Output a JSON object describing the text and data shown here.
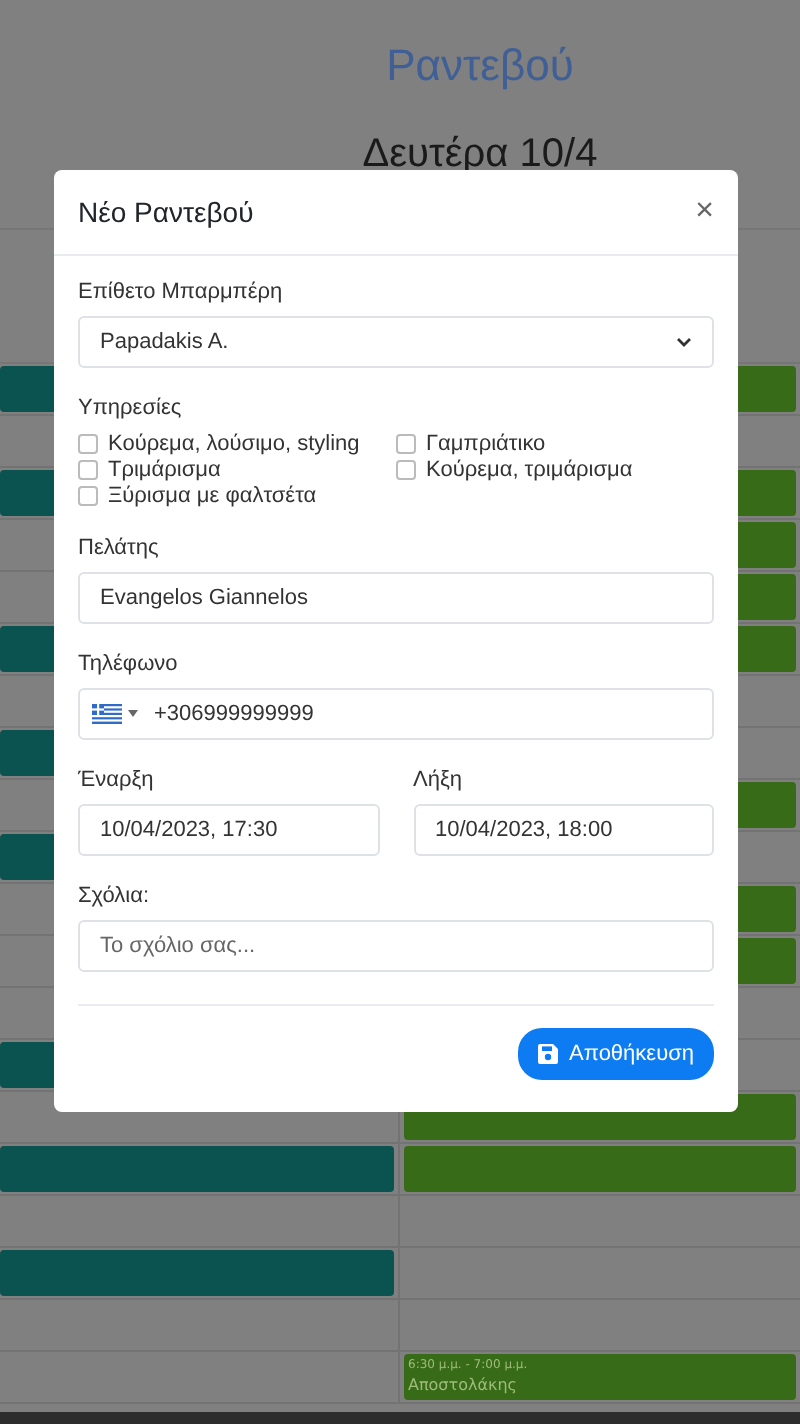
{
  "page": {
    "title": "Ραντεβού",
    "day_heading": "Δευτέρα 10/4"
  },
  "calendar": {
    "rows": [
      {
        "left_booked": true,
        "right_booked": true
      },
      {
        "left_booked": false,
        "right_booked": false
      },
      {
        "left_booked": true,
        "right_booked": true
      },
      {
        "left_booked": false,
        "right_booked": true
      },
      {
        "left_booked": false,
        "right_booked": true
      },
      {
        "left_booked": true,
        "right_booked": true
      },
      {
        "left_booked": false,
        "right_booked": false
      },
      {
        "left_booked": true,
        "right_booked": false
      },
      {
        "left_booked": false,
        "right_booked": true
      },
      {
        "left_booked": true,
        "right_booked": false
      },
      {
        "left_booked": false,
        "right_booked": true
      },
      {
        "left_booked": false,
        "right_booked": true
      },
      {
        "left_booked": false,
        "right_booked": false
      },
      {
        "left_booked": true,
        "right_booked": false
      },
      {
        "left_booked": false,
        "right_booked": true
      },
      {
        "left_booked": true,
        "right_booked": true
      },
      {
        "left_booked": false,
        "right_booked": false
      },
      {
        "left_booked": true,
        "right_booked": false
      },
      {
        "left_booked": false,
        "right_booked": false
      },
      {
        "left_booked": false,
        "right_booked": true,
        "right_time": "6:30 μ.μ. - 7:00 μ.μ.",
        "right_name": "Αποστολάκης"
      }
    ]
  },
  "modal": {
    "title": "Νέο Ραντεβού",
    "close": "×",
    "barber": {
      "label": "Επίθετο Μπαρμπέρη",
      "value": "Papadakis A."
    },
    "services": {
      "label": "Υπηρεσίες",
      "options": [
        {
          "label": "Κούρεμα, λούσιμο, styling",
          "checked": false
        },
        {
          "label": "Γαμπριάτικο",
          "checked": false
        },
        {
          "label": "Τριμάρισμα",
          "checked": false
        },
        {
          "label": "Κούρεμα, τριμάρισμα",
          "checked": false
        },
        {
          "label": "Ξύρισμα με φαλτσέτα",
          "checked": false
        }
      ]
    },
    "client": {
      "label": "Πελάτης",
      "value": "Evangelos Giannelos"
    },
    "phone": {
      "label": "Τηλέφωνο",
      "value": "+306999999999"
    },
    "start": {
      "label": "Έναρξη",
      "value": "10/04/2023, 17:30"
    },
    "end": {
      "label": "Λήξη",
      "value": "10/04/2023, 18:00"
    },
    "comments": {
      "label": "Σχόλια:",
      "placeholder": "Το σχόλιο σας..."
    },
    "save_button": "Αποθήκευση"
  }
}
